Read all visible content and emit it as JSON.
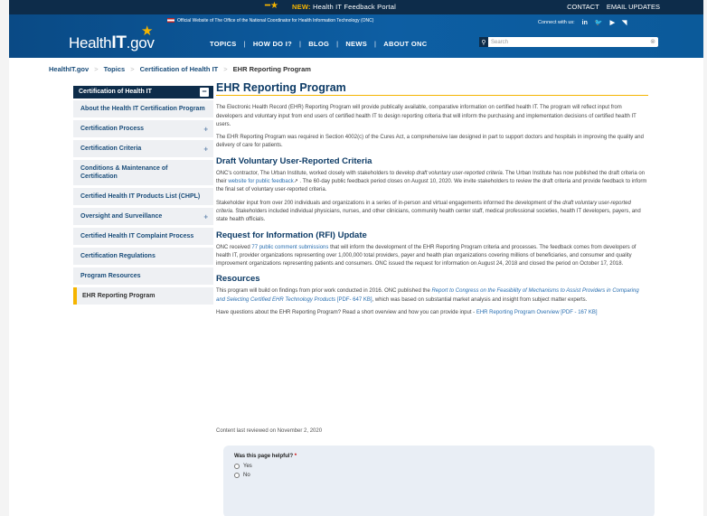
{
  "announcement": {
    "new_label": "NEW:",
    "text": "Health IT Feedback Portal",
    "links": [
      "CONTACT",
      "EMAIL UPDATES"
    ]
  },
  "header": {
    "logo_prefix": "Health",
    "logo_bold": "IT",
    "logo_suffix": ".gov",
    "official_text": "Official Website of The Office of the National Coordinator for Health Information Technology (ONC)",
    "connect_label": "Connect with us:",
    "social": [
      "in",
      "🐦",
      "▶",
      "RSS"
    ],
    "nav": [
      "TOPICS",
      "HOW DO I?",
      "BLOG",
      "NEWS",
      "ABOUT ONC"
    ],
    "search_placeholder": "Search"
  },
  "breadcrumb": [
    "HealthIT.gov",
    "Topics",
    "Certification of Health IT",
    "EHR Reporting Program"
  ],
  "sidebar": {
    "heading": "Certification of Health IT",
    "items": [
      {
        "label": "About the Health IT Certification Program",
        "expandable": false
      },
      {
        "label": "Certification Process",
        "expandable": true
      },
      {
        "label": "Certification Criteria",
        "expandable": true
      },
      {
        "label": "Conditions & Maintenance of Certification",
        "expandable": false
      },
      {
        "label": "Certified Health IT Products List (CHPL)",
        "expandable": false
      },
      {
        "label": "Oversight and Surveillance",
        "expandable": true
      },
      {
        "label": "Certified Health IT Complaint Process",
        "expandable": false
      },
      {
        "label": "Certification Regulations",
        "expandable": false
      },
      {
        "label": "Program Resources",
        "expandable": false
      },
      {
        "label": "EHR Reporting Program",
        "expandable": false,
        "active": true
      }
    ]
  },
  "main": {
    "title": "EHR Reporting Program",
    "intro_p1": "The Electronic Health Record (EHR) Reporting Program will provide publically available, comparative information on certified health IT. The program will reflect input from developers and voluntary input from end users of certified health IT to design reporting criteria that will inform the purchasing and implementation decisions of certified health IT users.",
    "intro_p2": "The EHR Reporting Program was required in Section 4002(c) of the Cures Act, a comprehensive law designed in part to support doctors and hospitals in improving the quality and delivery of care for patients.",
    "h_draft": "Draft Voluntary User-Reported Criteria",
    "draft_p1_a": "ONC's contractor, The Urban Institute, worked closely with stakeholders to develop ",
    "draft_p1_em": "draft voluntary user-reported criteria",
    "draft_p1_b": ". The Urban Institute has now published the draft criteria on their ",
    "draft_p1_link": "website for public feedback",
    "draft_p1_c": "↗ . The 60-day public feedback period closes on August 10, 2020. We invite stakeholders to review the draft criteria and provide feedback to inform the final set of voluntary user-reported criteria.",
    "draft_p2_a": "Stakeholder input from over 200 individuals and organizations in a series of in-person and virtual engagements informed the development of the ",
    "draft_p2_em": "draft voluntary user-reported criteria",
    "draft_p2_b": ". Stakeholders included individual physicians, nurses, and other clinicians, community health center staff, medical professional societies, health IT developers, payers, and state health officials.",
    "h_rfi": "Request for Information (RFI) Update",
    "rfi_a": "ONC received ",
    "rfi_link": "77 public comment submissions",
    "rfi_b": " that will inform the development of the EHR Reporting Program criteria and processes. The feedback comes from developers of health IT, provider organizations representing over 1,000,000 total providers, payer and health plan organizations covering millions of beneficiaries, and consumer and quality improvement organizations representing patients and consumers. ONC issued the request for information on August 24, 2018 and closed the period on October 17, 2018.",
    "h_resources": "Resources",
    "res_a": "This program will build on findings from prior work conducted in 2016. ONC published the ",
    "res_link": "Report to Congress on the Feasibility of Mechanisms to Assist Providers in Comparing and Selecting Certified EHR Technology Products",
    "res_link_tail": " [PDF- 647 KB]",
    "res_b": ", which was based on substantial market analysis and insight from subject matter experts.",
    "q_a": "Have questions about the EHR Reporting Program? Read a short overview and how you can provide input - ",
    "q_link": "EHR Reporting Program Overview [PDF - 167 KB]"
  },
  "reviewed": "Content last reviewed on November 2, 2020",
  "feedback": {
    "question": "Was this page helpful?",
    "required": "*",
    "options": [
      "Yes",
      "No"
    ]
  }
}
